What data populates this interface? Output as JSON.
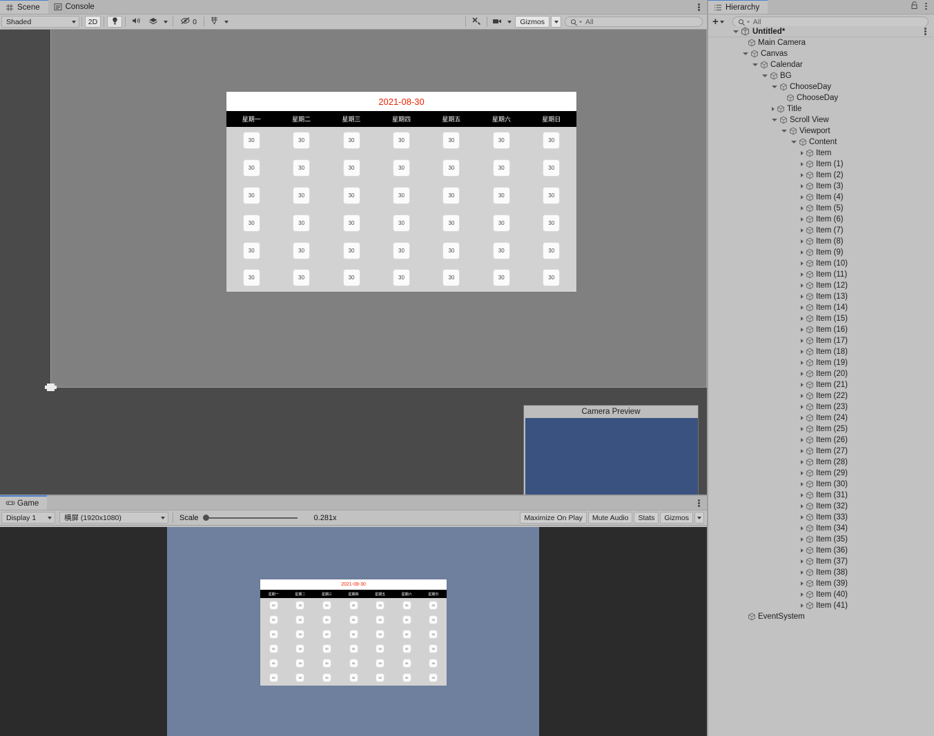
{
  "scene_panel": {
    "tabs": [
      {
        "label": "Scene",
        "icon": "grid-icon",
        "active": true
      },
      {
        "label": "Console",
        "icon": "console-icon",
        "active": false
      }
    ],
    "toolbar": {
      "shading_mode": "Shaded",
      "mode_2d": "2D",
      "lighting_icon": "lightbulb-icon",
      "audio_icon": "speaker-icon",
      "fx_icon": "effects-icon",
      "hidden_objects_icon": "eye-off-icon",
      "hidden_objects_count": "0",
      "grid_icon": "grid-snap-icon",
      "tools_icon": "tools-icon",
      "camera_icon": "camera-icon",
      "gizmos_label": "Gizmos",
      "search_placeholder": "All"
    }
  },
  "calendar": {
    "title": "2021-08-30",
    "title_color": "#ee2200",
    "weekdays": [
      "星期一",
      "星期二",
      "星期三",
      "星期四",
      "星期五",
      "星期六",
      "星期日"
    ],
    "weeks": [
      [
        "30",
        "30",
        "30",
        "30",
        "30",
        "30",
        "30"
      ],
      [
        "30",
        "30",
        "30",
        "30",
        "30",
        "30",
        "30"
      ],
      [
        "30",
        "30",
        "30",
        "30",
        "30",
        "30",
        "30"
      ],
      [
        "30",
        "30",
        "30",
        "30",
        "30",
        "30",
        "30"
      ],
      [
        "30",
        "30",
        "30",
        "30",
        "30",
        "30",
        "30"
      ],
      [
        "30",
        "30",
        "30",
        "30",
        "30",
        "30",
        "30"
      ]
    ]
  },
  "camera_preview": {
    "title": "Camera Preview",
    "background_color": "#3a5280"
  },
  "game_panel": {
    "tabs": [
      {
        "label": "Game",
        "icon": "gamepad-icon",
        "active": true
      }
    ],
    "toolbar": {
      "display": "Display 1",
      "aspect": "横屏 (1920x1080)",
      "scale_label": "Scale",
      "scale_value": "0.281x",
      "maximize_on_play": "Maximize On Play",
      "mute_audio": "Mute Audio",
      "stats": "Stats",
      "gizmos": "Gizmos"
    }
  },
  "hierarchy": {
    "tab": {
      "label": "Hierarchy",
      "icon": "hierarchy-icon"
    },
    "lock_icon": "lock-icon",
    "menu_icon": "kebab-menu-icon",
    "toolbar": {
      "add_label": "+",
      "search_placeholder": "All"
    },
    "scene_row": {
      "label": "Untitled*",
      "icon": "unity-scene-icon",
      "expanded": true
    },
    "items": [
      {
        "label": "Main Camera",
        "depth": 1,
        "arrow": "none"
      },
      {
        "label": "Canvas",
        "depth": 1,
        "arrow": "open"
      },
      {
        "label": "Calendar",
        "depth": 2,
        "arrow": "open"
      },
      {
        "label": "BG",
        "depth": 3,
        "arrow": "open"
      },
      {
        "label": "ChooseDay",
        "depth": 4,
        "arrow": "open"
      },
      {
        "label": "ChooseDay",
        "depth": 5,
        "arrow": "none"
      },
      {
        "label": "Title",
        "depth": 4,
        "arrow": "closed"
      },
      {
        "label": "Scroll View",
        "depth": 4,
        "arrow": "open"
      },
      {
        "label": "Viewport",
        "depth": 5,
        "arrow": "open"
      },
      {
        "label": "Content",
        "depth": 6,
        "arrow": "open"
      },
      {
        "label": "Item",
        "depth": 7,
        "arrow": "closed"
      },
      {
        "label": "Item (1)",
        "depth": 7,
        "arrow": "closed"
      },
      {
        "label": "Item (2)",
        "depth": 7,
        "arrow": "closed"
      },
      {
        "label": "Item (3)",
        "depth": 7,
        "arrow": "closed"
      },
      {
        "label": "Item (4)",
        "depth": 7,
        "arrow": "closed"
      },
      {
        "label": "Item (5)",
        "depth": 7,
        "arrow": "closed"
      },
      {
        "label": "Item (6)",
        "depth": 7,
        "arrow": "closed"
      },
      {
        "label": "Item (7)",
        "depth": 7,
        "arrow": "closed"
      },
      {
        "label": "Item (8)",
        "depth": 7,
        "arrow": "closed"
      },
      {
        "label": "Item (9)",
        "depth": 7,
        "arrow": "closed"
      },
      {
        "label": "Item (10)",
        "depth": 7,
        "arrow": "closed"
      },
      {
        "label": "Item (11)",
        "depth": 7,
        "arrow": "closed"
      },
      {
        "label": "Item (12)",
        "depth": 7,
        "arrow": "closed"
      },
      {
        "label": "Item (13)",
        "depth": 7,
        "arrow": "closed"
      },
      {
        "label": "Item (14)",
        "depth": 7,
        "arrow": "closed"
      },
      {
        "label": "Item (15)",
        "depth": 7,
        "arrow": "closed"
      },
      {
        "label": "Item (16)",
        "depth": 7,
        "arrow": "closed"
      },
      {
        "label": "Item (17)",
        "depth": 7,
        "arrow": "closed"
      },
      {
        "label": "Item (18)",
        "depth": 7,
        "arrow": "closed"
      },
      {
        "label": "Item (19)",
        "depth": 7,
        "arrow": "closed"
      },
      {
        "label": "Item (20)",
        "depth": 7,
        "arrow": "closed"
      },
      {
        "label": "Item (21)",
        "depth": 7,
        "arrow": "closed"
      },
      {
        "label": "Item (22)",
        "depth": 7,
        "arrow": "closed"
      },
      {
        "label": "Item (23)",
        "depth": 7,
        "arrow": "closed"
      },
      {
        "label": "Item (24)",
        "depth": 7,
        "arrow": "closed"
      },
      {
        "label": "Item (25)",
        "depth": 7,
        "arrow": "closed"
      },
      {
        "label": "Item (26)",
        "depth": 7,
        "arrow": "closed"
      },
      {
        "label": "Item (27)",
        "depth": 7,
        "arrow": "closed"
      },
      {
        "label": "Item (28)",
        "depth": 7,
        "arrow": "closed"
      },
      {
        "label": "Item (29)",
        "depth": 7,
        "arrow": "closed"
      },
      {
        "label": "Item (30)",
        "depth": 7,
        "arrow": "closed"
      },
      {
        "label": "Item (31)",
        "depth": 7,
        "arrow": "closed"
      },
      {
        "label": "Item (32)",
        "depth": 7,
        "arrow": "closed"
      },
      {
        "label": "Item (33)",
        "depth": 7,
        "arrow": "closed"
      },
      {
        "label": "Item (34)",
        "depth": 7,
        "arrow": "closed"
      },
      {
        "label": "Item (35)",
        "depth": 7,
        "arrow": "closed"
      },
      {
        "label": "Item (36)",
        "depth": 7,
        "arrow": "closed"
      },
      {
        "label": "Item (37)",
        "depth": 7,
        "arrow": "closed"
      },
      {
        "label": "Item (38)",
        "depth": 7,
        "arrow": "closed"
      },
      {
        "label": "Item (39)",
        "depth": 7,
        "arrow": "closed"
      },
      {
        "label": "Item (40)",
        "depth": 7,
        "arrow": "closed"
      },
      {
        "label": "Item (41)",
        "depth": 7,
        "arrow": "closed"
      },
      {
        "label": "EventSystem",
        "depth": 1,
        "arrow": "none"
      }
    ]
  }
}
